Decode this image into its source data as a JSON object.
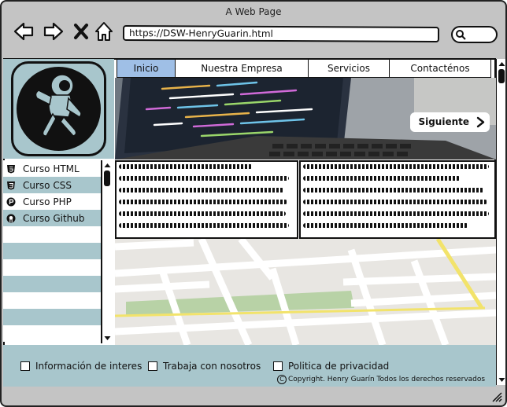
{
  "window": {
    "title": "A Web Page",
    "url": "https://DSW-HenryGuarin.html"
  },
  "nav": {
    "back_icon": "arrow-left-icon",
    "forward_icon": "arrow-right-icon",
    "stop_icon": "close-icon",
    "home_icon": "home-icon",
    "search_icon": "search-icon"
  },
  "menu": {
    "tabs": [
      {
        "label": "Inicio",
        "active": true
      },
      {
        "label": "Nuestra Empresa",
        "active": false
      },
      {
        "label": "Servicios",
        "active": false
      },
      {
        "label": "Contacténos",
        "active": false
      }
    ]
  },
  "hero": {
    "next_label": "Siguiente"
  },
  "courses": {
    "items": [
      {
        "label": "Curso HTML",
        "icon": "html5-icon"
      },
      {
        "label": "Curso CSS",
        "icon": "css3-icon"
      },
      {
        "label": "Curso PHP",
        "icon": "php-icon"
      },
      {
        "label": "Curso Github",
        "icon": "github-icon"
      }
    ]
  },
  "footer": {
    "links": [
      {
        "label": "Información de interes"
      },
      {
        "label": "Trabaja con nosotros"
      },
      {
        "label": "Politica de privacidad"
      }
    ],
    "copyright": "Copyright. Henry Guarín Todos los derechos reservados"
  },
  "colors": {
    "teal": "#a8c6cc",
    "active_tab": "#9fbfe6",
    "window": "#c4c4c4"
  }
}
